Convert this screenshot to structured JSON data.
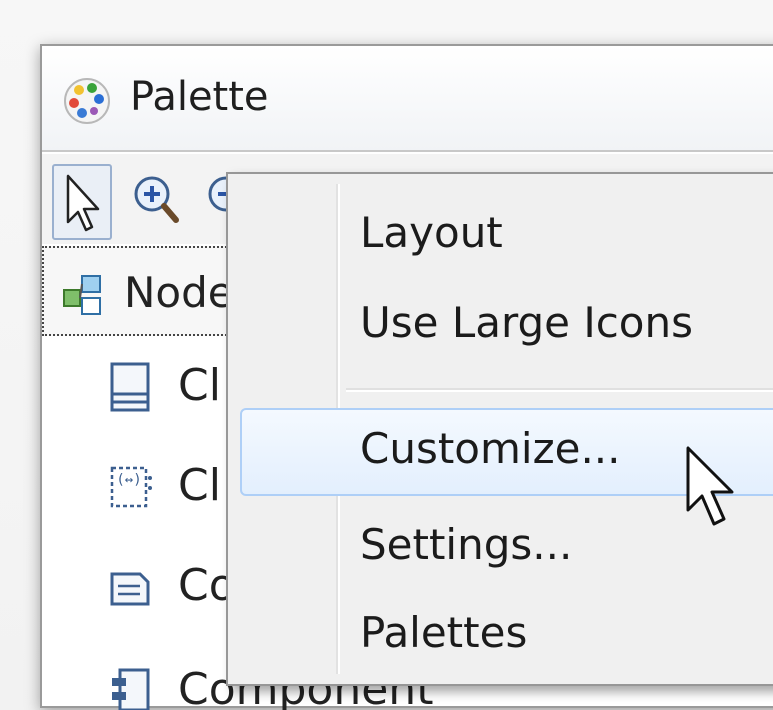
{
  "window": {
    "title": "Palette",
    "icon": "palette-icon"
  },
  "toolbar": {
    "tools": [
      {
        "name": "select-tool",
        "icon": "arrow-pointer-icon"
      },
      {
        "name": "zoom-in-tool",
        "icon": "zoom-in-icon"
      },
      {
        "name": "zoom-out-tool",
        "icon": "zoom-out-icon"
      }
    ]
  },
  "drawer": {
    "label": "Node",
    "icon": "node-group-icon",
    "items": [
      {
        "label": "Cl",
        "icon": "class-icon"
      },
      {
        "label": "Cl",
        "icon": "collaboration-icon"
      },
      {
        "label": "Co",
        "icon": "comment-icon"
      },
      {
        "label": "Component",
        "icon": "component-icon"
      }
    ]
  },
  "context_menu": {
    "items": [
      {
        "label": "Layout"
      },
      {
        "label": "Use Large Icons"
      },
      {
        "label": "Customize...",
        "highlighted": true
      },
      {
        "label": "Settings..."
      },
      {
        "label": "Palettes"
      }
    ]
  },
  "colors": {
    "menu_highlight_border": "#aecff7",
    "menu_background": "#f0f0f0",
    "select_tool_border": "#9ab0cf"
  }
}
